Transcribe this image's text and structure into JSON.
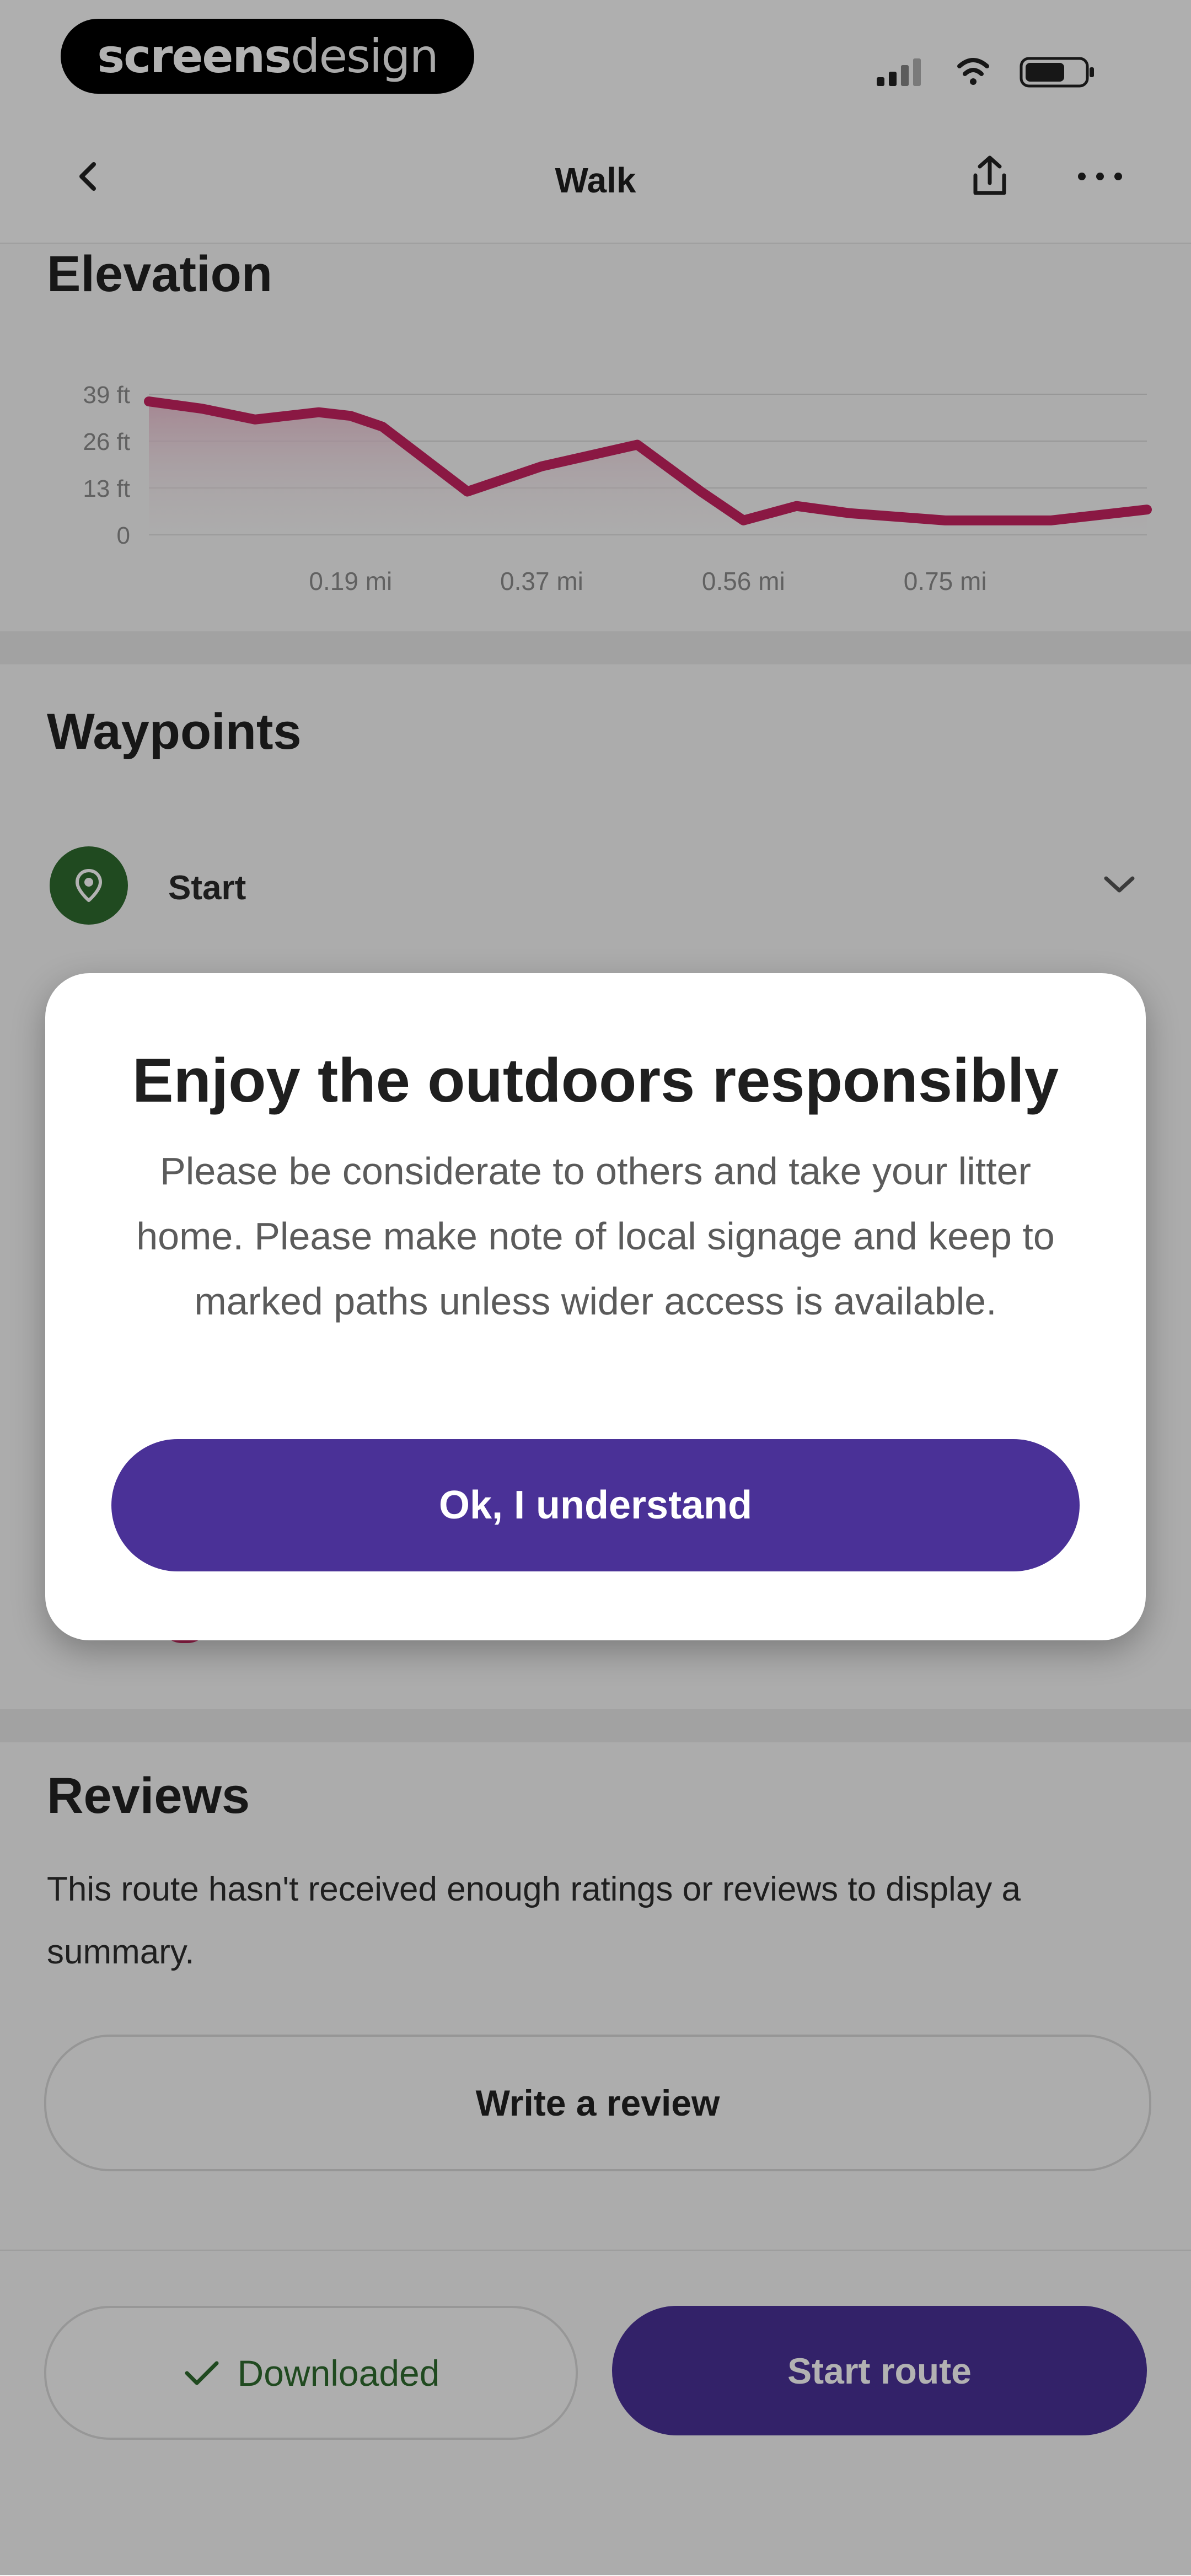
{
  "watermark": {
    "part1": "screens",
    "part2": "design"
  },
  "header": {
    "title": "Walk"
  },
  "elevation": {
    "heading": "Elevation"
  },
  "chart_data": {
    "type": "area",
    "x": [
      0,
      0.05,
      0.1,
      0.16,
      0.19,
      0.22,
      0.3,
      0.37,
      0.46,
      0.52,
      0.56,
      0.61,
      0.66,
      0.75,
      0.85,
      0.94
    ],
    "series": [
      {
        "values": [
          37,
          35,
          32,
          34,
          33,
          30,
          12,
          19,
          25,
          12,
          4,
          8,
          6,
          4,
          4,
          7
        ]
      }
    ],
    "y_ticks": [
      "39 ft",
      "26 ft",
      "13 ft",
      "0"
    ],
    "x_ticks": [
      "0.19 mi",
      "0.37 mi",
      "0.56 mi",
      "0.75 mi"
    ],
    "x_tick_values": [
      0.19,
      0.37,
      0.56,
      0.75
    ],
    "y_tick_values": [
      39,
      26,
      13,
      0
    ],
    "ylim": [
      0,
      39
    ],
    "xlim": [
      0,
      0.94
    ],
    "xlabel": "",
    "ylabel": "",
    "grid": true,
    "colors": {
      "line": "#c62361",
      "fill_top": "#ecbfd0",
      "fill_bottom": "#f6f6f6",
      "grid": "#d9d9d9",
      "tick": "#8b8b8b"
    }
  },
  "waypoints": {
    "heading": "Waypoints",
    "items": [
      {
        "label": "Start"
      }
    ]
  },
  "reviews": {
    "heading": "Reviews",
    "summary": "This route hasn't received enough ratings or reviews to display a summary.",
    "write_review_label": "Write a review"
  },
  "actions": {
    "downloaded_label": "Downloaded",
    "start_route_label": "Start route"
  },
  "modal": {
    "title": "Enjoy the outdoors responsibly",
    "body": "Please be considerate to others and take your litter home. Please make note of local signage and keep to marked paths unless wider access is available.",
    "button_label": "Ok, I understand"
  },
  "theme": {
    "accent": "#4a3197",
    "green": "#2f6a2f",
    "pink": "#cf2b65"
  }
}
